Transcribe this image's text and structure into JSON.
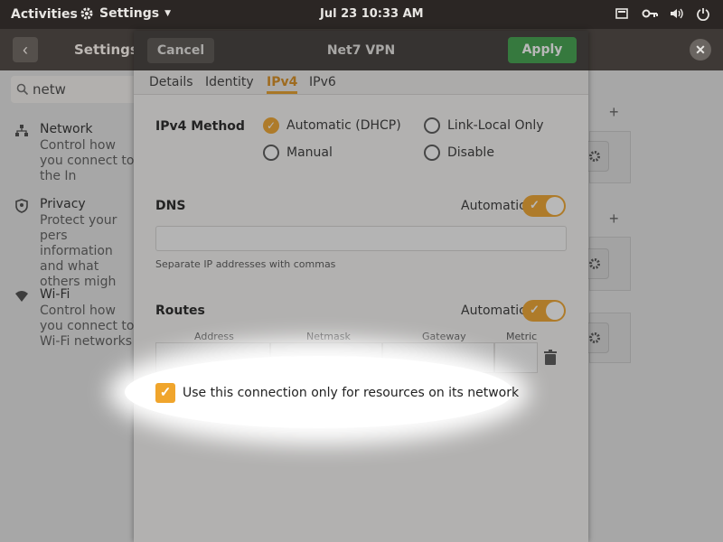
{
  "topbar": {
    "activities": "Activities",
    "app_name": "Settings",
    "clock": "Jul 23  10:33 AM",
    "icons": [
      "screen-icon",
      "key-icon",
      "volume-icon",
      "power-icon"
    ]
  },
  "settings": {
    "title": "Settings",
    "search_value": "netw",
    "sidebar": [
      {
        "label": "Network",
        "desc": "Control how you connect to the In",
        "icon": "network-icon"
      },
      {
        "label": "Privacy",
        "desc": "Protect your pers information and what others migh",
        "icon": "shield-icon"
      },
      {
        "label": "Wi-Fi",
        "desc": "Control how you connect to Wi-Fi networks",
        "icon": "wifi-icon"
      }
    ]
  },
  "dialog": {
    "cancel_label": "Cancel",
    "title": "Net7 VPN",
    "apply_label": "Apply",
    "tabs": [
      "Details",
      "Identity",
      "IPv4",
      "IPv6"
    ],
    "active_tab": "IPv4",
    "ipv4_method_label": "IPv4 Method",
    "methods": [
      {
        "label": "Automatic (DHCP)",
        "selected": true
      },
      {
        "label": "Link-Local Only",
        "selected": false
      },
      {
        "label": "Manual",
        "selected": false
      },
      {
        "label": "Disable",
        "selected": false
      }
    ],
    "dns_label": "DNS",
    "dns_auto_label": "Automatic",
    "dns_auto_on": true,
    "dns_value": "",
    "dns_hint": "Separate IP addresses with commas",
    "routes_label": "Routes",
    "routes_auto_label": "Automatic",
    "routes_auto_on": true,
    "route_columns": [
      "Address",
      "Netmask",
      "Gateway",
      "Metric"
    ],
    "only_resources_label": "Use this connection only for resources on its network",
    "only_resources_checked": true
  },
  "colors": {
    "accent": "#f0a52c",
    "apply_green": "#3ea14a",
    "header_dark": "#3e3936"
  }
}
